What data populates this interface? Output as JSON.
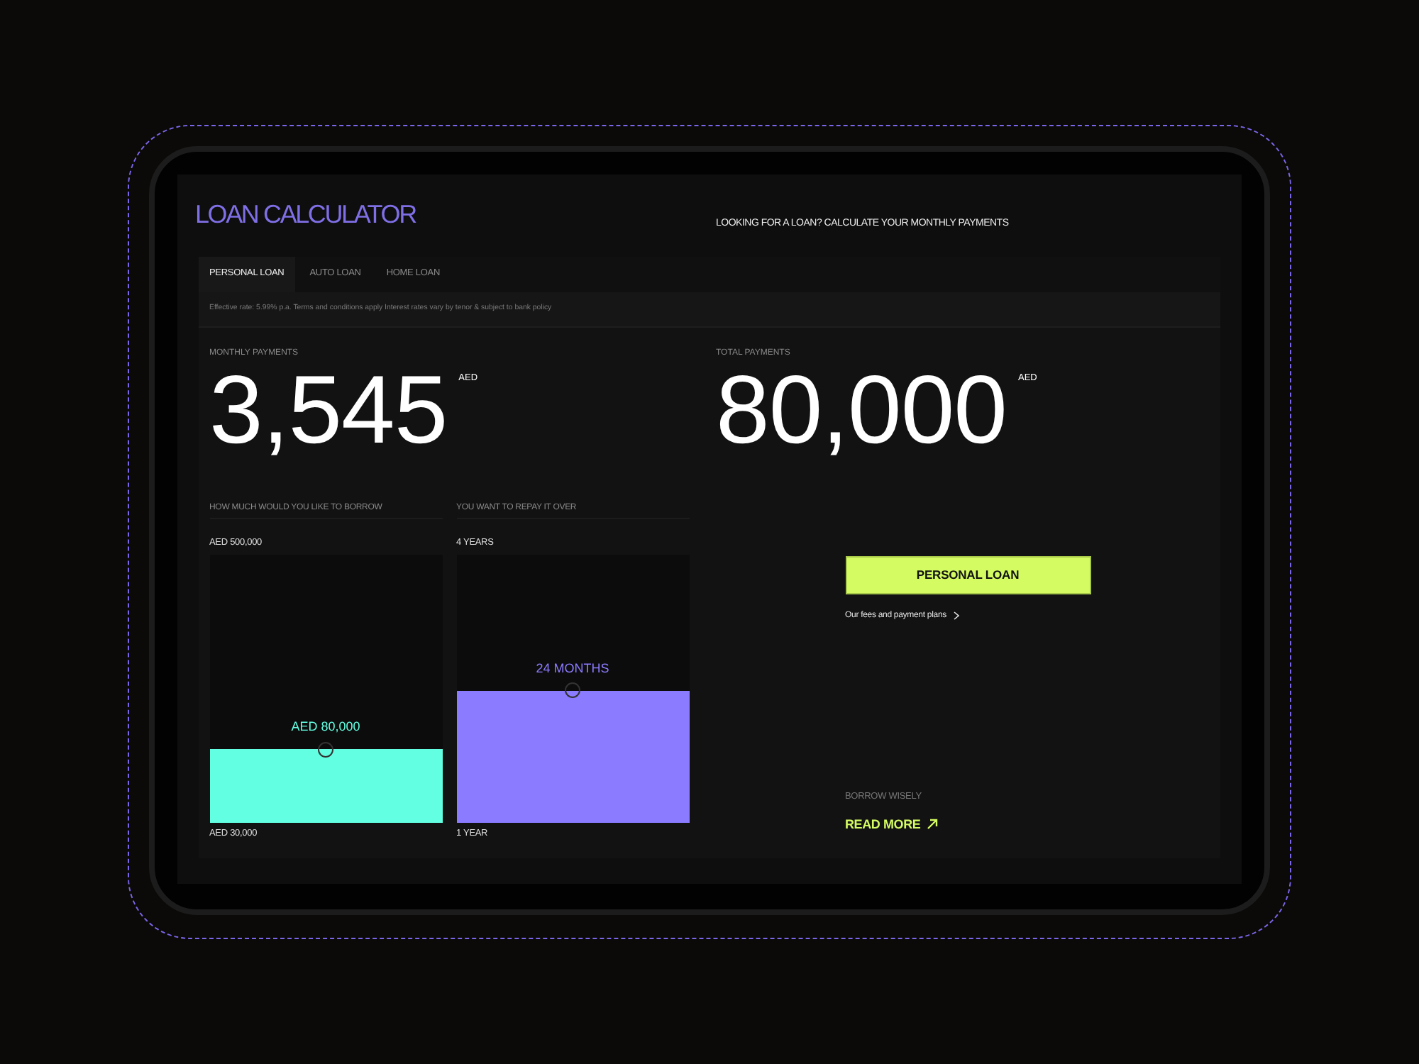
{
  "header": {
    "title": "LOAN CALCULATOR",
    "subtitle": "LOOKING FOR A LOAN? CALCULATE YOUR MONTHLY PAYMENTS"
  },
  "tabs": [
    {
      "label": "PERSONAL LOAN",
      "selected": true
    },
    {
      "label": "AUTO LOAN",
      "selected": false
    },
    {
      "label": "HOME LOAN",
      "selected": false
    }
  ],
  "note": "Effective rate: 5.99% p.a. Terms and conditions apply Interest rates vary by tenor & subject to bank policy",
  "results": [
    {
      "label": "MONTHLY PAYMENTS",
      "value": "3,545",
      "currency": "AED"
    },
    {
      "label": "TOTAL PAYMENTS",
      "value": "80,000",
      "currency": "AED"
    }
  ],
  "sliders": [
    {
      "label": "HOW MUCH WOULD YOU LIKE TO BORROW",
      "max": "AED 500,000",
      "min": "AED 30,000",
      "value": "AED 80,000",
      "level": 0.27,
      "color": "#62ffe2"
    },
    {
      "label": "YOU WANT TO REPAY IT OVER",
      "max": "4 YEARS",
      "min": "1 YEAR",
      "value": "24 MONTHS",
      "level": 0.49,
      "color": "#8b7bff"
    }
  ],
  "apply_button": "PERSONAL LOAN",
  "fees_link": "Our fees and payment plans",
  "promo": {
    "label": "BORROW WISELY",
    "link": "READ MORE"
  }
}
